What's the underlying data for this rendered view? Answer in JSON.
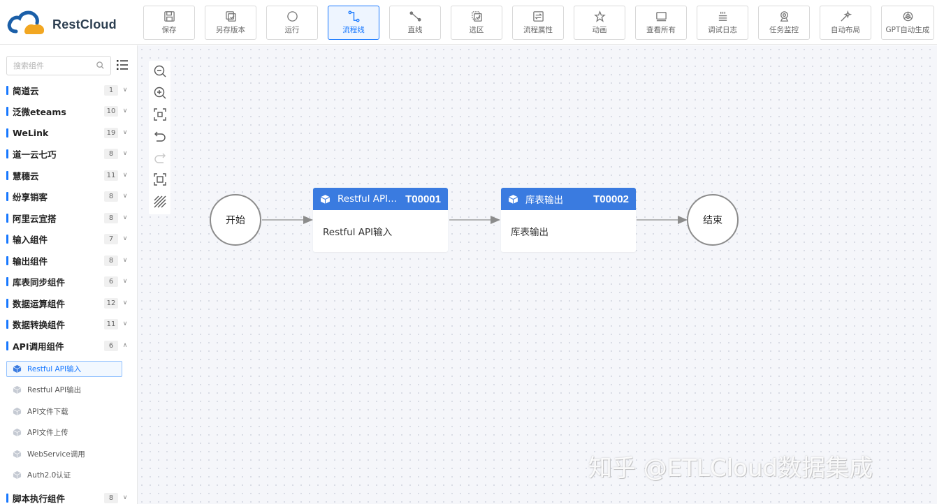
{
  "brand": {
    "name": "RestCloud",
    "accent": "#1677ff",
    "node_header": "#3a7be0"
  },
  "toolbar": [
    {
      "label": "保存",
      "icon": "save-icon"
    },
    {
      "label": "另存版本",
      "icon": "save-version-icon"
    },
    {
      "label": "运行",
      "icon": "run-icon"
    },
    {
      "label": "流程线",
      "icon": "flow-line-icon",
      "active": true
    },
    {
      "label": "直线",
      "icon": "straight-line-icon"
    },
    {
      "label": "选区",
      "icon": "select-area-icon"
    },
    {
      "label": "流程属性",
      "icon": "flow-properties-icon"
    },
    {
      "label": "动画",
      "icon": "animation-icon"
    },
    {
      "label": "查看所有",
      "icon": "view-all-icon"
    },
    {
      "label": "调试日志",
      "icon": "debug-log-icon"
    },
    {
      "label": "任务监控",
      "icon": "task-monitor-icon"
    },
    {
      "label": "自动布局",
      "icon": "auto-layout-icon"
    },
    {
      "label": "GPT自动生成",
      "icon": "gpt-icon"
    }
  ],
  "sidebar": {
    "search_placeholder": "搜索组件",
    "categories": [
      {
        "name": "简道云",
        "count": "1",
        "expanded": false
      },
      {
        "name": "泛微eteams",
        "count": "10",
        "expanded": false
      },
      {
        "name": "WeLink",
        "count": "19",
        "expanded": false
      },
      {
        "name": "道一云七巧",
        "count": "8",
        "expanded": false
      },
      {
        "name": "慧穗云",
        "count": "11",
        "expanded": false
      },
      {
        "name": "纷享销客",
        "count": "8",
        "expanded": false
      },
      {
        "name": "阿里云宜搭",
        "count": "8",
        "expanded": false
      },
      {
        "name": "输入组件",
        "count": "7",
        "expanded": false
      },
      {
        "name": "输出组件",
        "count": "8",
        "expanded": false
      },
      {
        "name": "库表同步组件",
        "count": "6",
        "expanded": false
      },
      {
        "name": "数据运算组件",
        "count": "12",
        "expanded": false
      },
      {
        "name": "数据转换组件",
        "count": "11",
        "expanded": false
      },
      {
        "name": "API调用组件",
        "count": "6",
        "expanded": true
      }
    ],
    "api_items": [
      {
        "name": "Restful API输入",
        "selected": true
      },
      {
        "name": "Restful API输出",
        "selected": false
      },
      {
        "name": "API文件下载",
        "selected": false
      },
      {
        "name": "API文件上传",
        "selected": false
      },
      {
        "name": "WebService调用",
        "selected": false
      },
      {
        "name": "Auth2.0认证",
        "selected": false
      }
    ],
    "last_category": {
      "name": "脚本执行组件",
      "count": "8"
    }
  },
  "canvas_tools": [
    {
      "icon": "zoom-out-icon"
    },
    {
      "icon": "zoom-in-icon"
    },
    {
      "icon": "fit-view-icon"
    },
    {
      "icon": "undo-icon"
    },
    {
      "icon": "redo-icon",
      "disabled": true
    },
    {
      "icon": "fullscreen-icon"
    },
    {
      "icon": "grid-toggle-icon"
    }
  ],
  "flow": {
    "start": "开始",
    "end": "结束",
    "tasks": [
      {
        "title": "Restful API...",
        "id": "T00001",
        "body": "Restful API输入"
      },
      {
        "title": "库表输出",
        "id": "T00002",
        "body": "库表输出"
      }
    ]
  },
  "watermark": "知乎 @ETLCloud数据集成"
}
